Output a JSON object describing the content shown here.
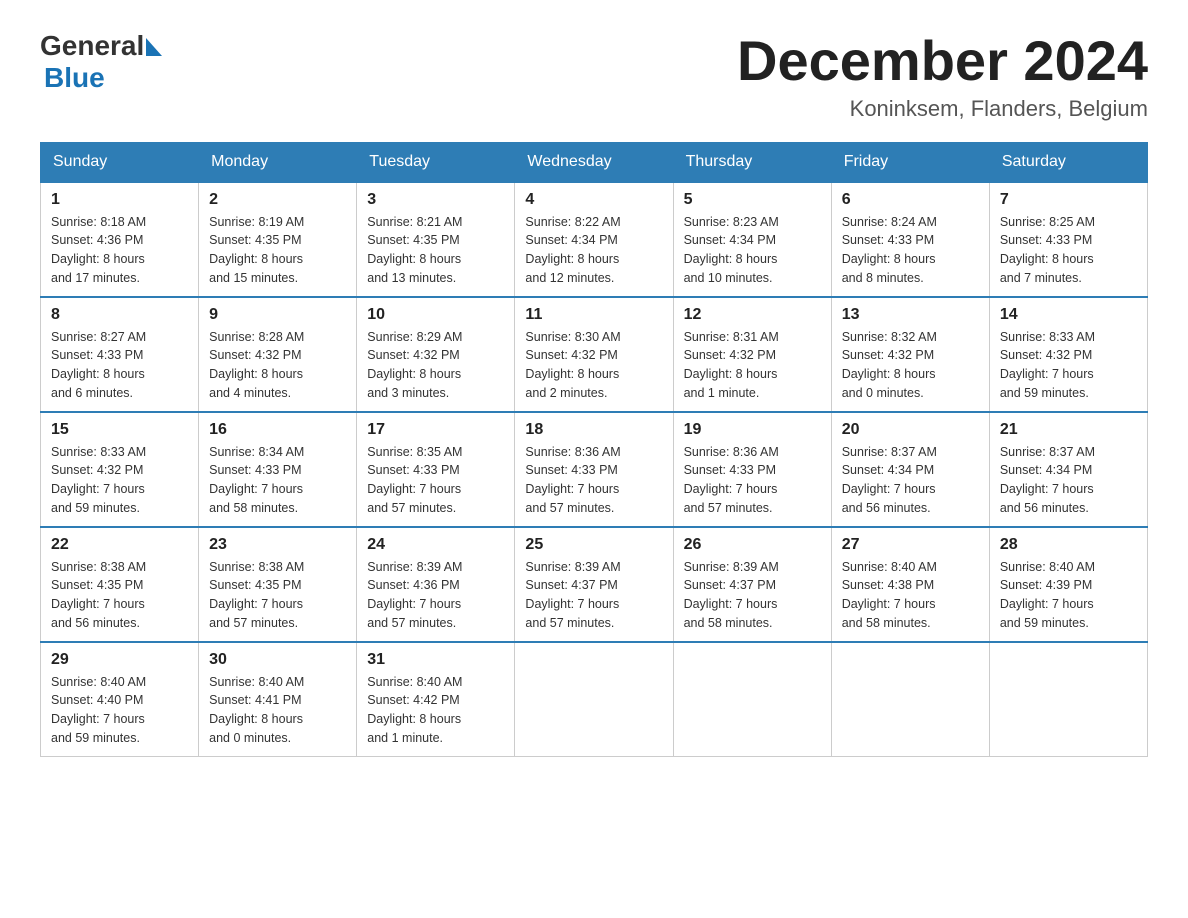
{
  "header": {
    "logo_general": "General",
    "logo_blue": "Blue",
    "month_title": "December 2024",
    "location": "Koninksem, Flanders, Belgium"
  },
  "days_of_week": [
    "Sunday",
    "Monday",
    "Tuesday",
    "Wednesday",
    "Thursday",
    "Friday",
    "Saturday"
  ],
  "weeks": [
    [
      {
        "day": "1",
        "sunrise": "8:18 AM",
        "sunset": "4:36 PM",
        "daylight": "8 hours and 17 minutes."
      },
      {
        "day": "2",
        "sunrise": "8:19 AM",
        "sunset": "4:35 PM",
        "daylight": "8 hours and 15 minutes."
      },
      {
        "day": "3",
        "sunrise": "8:21 AM",
        "sunset": "4:35 PM",
        "daylight": "8 hours and 13 minutes."
      },
      {
        "day": "4",
        "sunrise": "8:22 AM",
        "sunset": "4:34 PM",
        "daylight": "8 hours and 12 minutes."
      },
      {
        "day": "5",
        "sunrise": "8:23 AM",
        "sunset": "4:34 PM",
        "daylight": "8 hours and 10 minutes."
      },
      {
        "day": "6",
        "sunrise": "8:24 AM",
        "sunset": "4:33 PM",
        "daylight": "8 hours and 8 minutes."
      },
      {
        "day": "7",
        "sunrise": "8:25 AM",
        "sunset": "4:33 PM",
        "daylight": "8 hours and 7 minutes."
      }
    ],
    [
      {
        "day": "8",
        "sunrise": "8:27 AM",
        "sunset": "4:33 PM",
        "daylight": "8 hours and 6 minutes."
      },
      {
        "day": "9",
        "sunrise": "8:28 AM",
        "sunset": "4:32 PM",
        "daylight": "8 hours and 4 minutes."
      },
      {
        "day": "10",
        "sunrise": "8:29 AM",
        "sunset": "4:32 PM",
        "daylight": "8 hours and 3 minutes."
      },
      {
        "day": "11",
        "sunrise": "8:30 AM",
        "sunset": "4:32 PM",
        "daylight": "8 hours and 2 minutes."
      },
      {
        "day": "12",
        "sunrise": "8:31 AM",
        "sunset": "4:32 PM",
        "daylight": "8 hours and 1 minute."
      },
      {
        "day": "13",
        "sunrise": "8:32 AM",
        "sunset": "4:32 PM",
        "daylight": "8 hours and 0 minutes."
      },
      {
        "day": "14",
        "sunrise": "8:33 AM",
        "sunset": "4:32 PM",
        "daylight": "7 hours and 59 minutes."
      }
    ],
    [
      {
        "day": "15",
        "sunrise": "8:33 AM",
        "sunset": "4:32 PM",
        "daylight": "7 hours and 59 minutes."
      },
      {
        "day": "16",
        "sunrise": "8:34 AM",
        "sunset": "4:33 PM",
        "daylight": "7 hours and 58 minutes."
      },
      {
        "day": "17",
        "sunrise": "8:35 AM",
        "sunset": "4:33 PM",
        "daylight": "7 hours and 57 minutes."
      },
      {
        "day": "18",
        "sunrise": "8:36 AM",
        "sunset": "4:33 PM",
        "daylight": "7 hours and 57 minutes."
      },
      {
        "day": "19",
        "sunrise": "8:36 AM",
        "sunset": "4:33 PM",
        "daylight": "7 hours and 57 minutes."
      },
      {
        "day": "20",
        "sunrise": "8:37 AM",
        "sunset": "4:34 PM",
        "daylight": "7 hours and 56 minutes."
      },
      {
        "day": "21",
        "sunrise": "8:37 AM",
        "sunset": "4:34 PM",
        "daylight": "7 hours and 56 minutes."
      }
    ],
    [
      {
        "day": "22",
        "sunrise": "8:38 AM",
        "sunset": "4:35 PM",
        "daylight": "7 hours and 56 minutes."
      },
      {
        "day": "23",
        "sunrise": "8:38 AM",
        "sunset": "4:35 PM",
        "daylight": "7 hours and 57 minutes."
      },
      {
        "day": "24",
        "sunrise": "8:39 AM",
        "sunset": "4:36 PM",
        "daylight": "7 hours and 57 minutes."
      },
      {
        "day": "25",
        "sunrise": "8:39 AM",
        "sunset": "4:37 PM",
        "daylight": "7 hours and 57 minutes."
      },
      {
        "day": "26",
        "sunrise": "8:39 AM",
        "sunset": "4:37 PM",
        "daylight": "7 hours and 58 minutes."
      },
      {
        "day": "27",
        "sunrise": "8:40 AM",
        "sunset": "4:38 PM",
        "daylight": "7 hours and 58 minutes."
      },
      {
        "day": "28",
        "sunrise": "8:40 AM",
        "sunset": "4:39 PM",
        "daylight": "7 hours and 59 minutes."
      }
    ],
    [
      {
        "day": "29",
        "sunrise": "8:40 AM",
        "sunset": "4:40 PM",
        "daylight": "7 hours and 59 minutes."
      },
      {
        "day": "30",
        "sunrise": "8:40 AM",
        "sunset": "4:41 PM",
        "daylight": "8 hours and 0 minutes."
      },
      {
        "day": "31",
        "sunrise": "8:40 AM",
        "sunset": "4:42 PM",
        "daylight": "8 hours and 1 minute."
      },
      null,
      null,
      null,
      null
    ]
  ],
  "labels": {
    "sunrise": "Sunrise:",
    "sunset": "Sunset:",
    "daylight": "Daylight:"
  }
}
